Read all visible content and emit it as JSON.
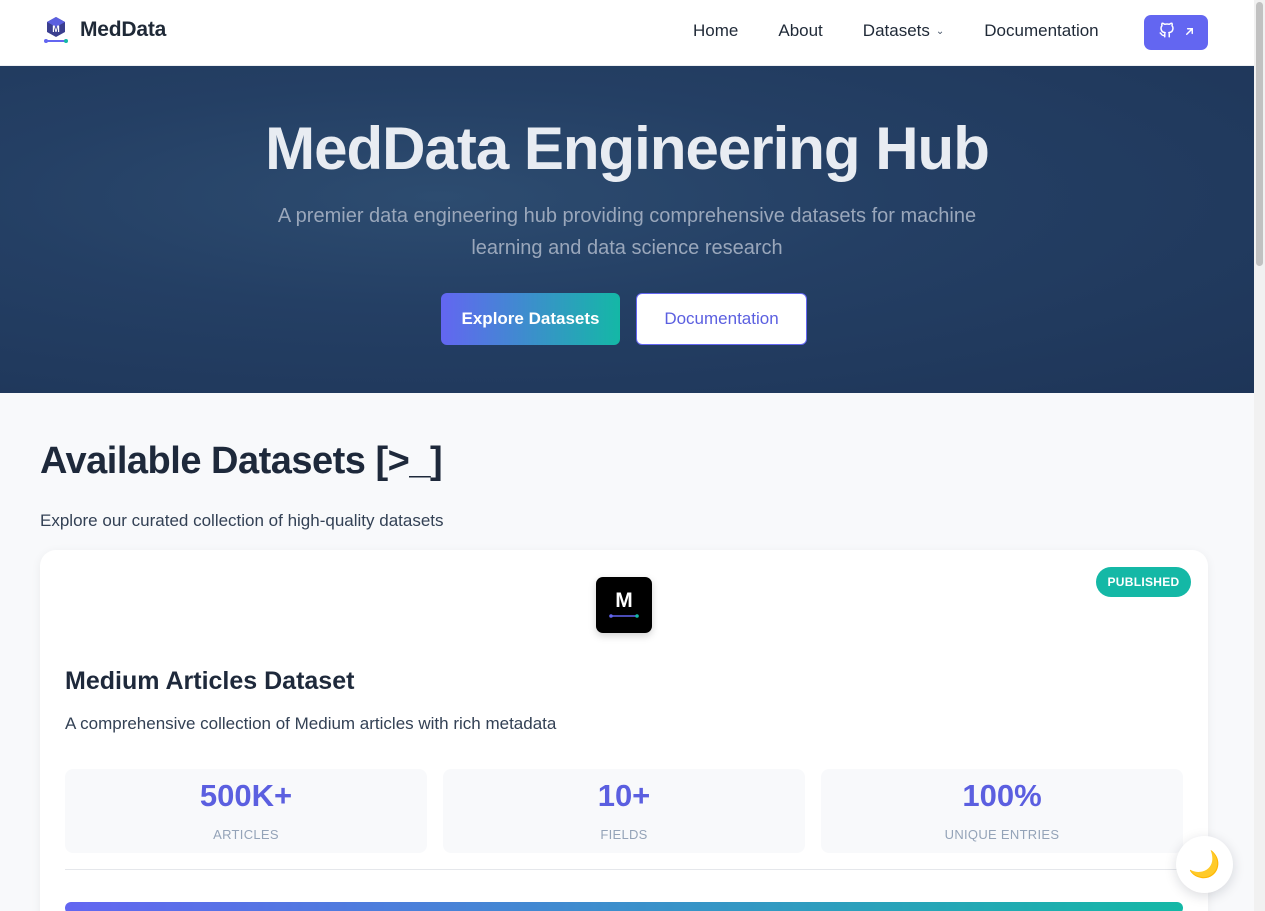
{
  "brand": {
    "name": "MedData"
  },
  "nav": {
    "links": [
      {
        "label": "Home"
      },
      {
        "label": "About"
      },
      {
        "label": "Datasets"
      },
      {
        "label": "Documentation"
      }
    ],
    "github_icon": "github-icon",
    "external_icon": "arrow-up-right-icon"
  },
  "hero": {
    "title": "MedData Engineering Hub",
    "subtitle": "A premier data engineering hub providing comprehensive datasets for machine learning and data science research",
    "primary_button": "Explore Datasets",
    "secondary_button": "Documentation"
  },
  "section": {
    "title": "Available Datasets [>_]",
    "subtitle": "Explore our curated collection of high-quality datasets"
  },
  "dataset": {
    "logo_letter": "M",
    "status": "PUBLISHED",
    "title": "Medium Articles Dataset",
    "description": "A comprehensive collection of Medium articles with rich metadata",
    "stats": [
      {
        "value": "500K+",
        "label": "ARTICLES"
      },
      {
        "value": "10+",
        "label": "FIELDS"
      },
      {
        "value": "100%",
        "label": "UNIQUE ENTRIES"
      }
    ]
  },
  "theme_toggle": {
    "icon": "🌙"
  },
  "colors": {
    "accent": "#6366f1",
    "teal": "#14b8a6",
    "hero_bg": "#243f64"
  }
}
